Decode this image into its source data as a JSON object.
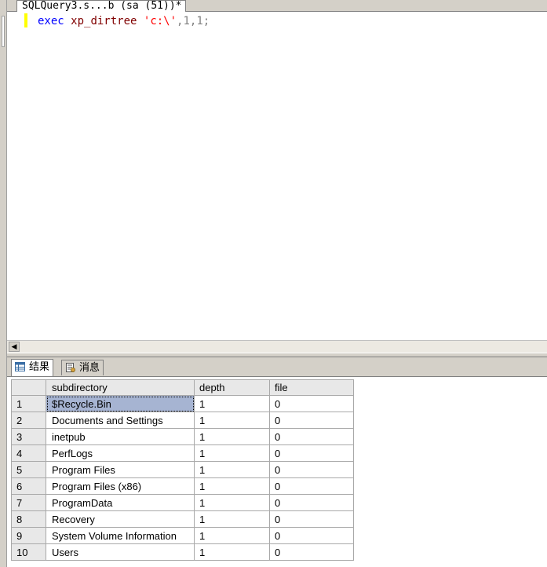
{
  "document_tab": {
    "title": "SQLQuery3.s...b (sa (51))*"
  },
  "editor": {
    "tokens": {
      "keyword": "exec",
      "procedure": "xp_dirtree",
      "string": "'c:\\'",
      "args": ",1,1;"
    }
  },
  "results_tabs": [
    {
      "label": "结果",
      "icon": "grid-icon",
      "active": true
    },
    {
      "label": "消息",
      "icon": "messages-icon",
      "active": false
    }
  ],
  "grid": {
    "columns": [
      "subdirectory",
      "depth",
      "file"
    ],
    "rows": [
      {
        "num": "1",
        "subdirectory": "$Recycle.Bin",
        "depth": "1",
        "file": "0"
      },
      {
        "num": "2",
        "subdirectory": "Documents and Settings",
        "depth": "1",
        "file": "0"
      },
      {
        "num": "3",
        "subdirectory": "inetpub",
        "depth": "1",
        "file": "0"
      },
      {
        "num": "4",
        "subdirectory": "PerfLogs",
        "depth": "1",
        "file": "0"
      },
      {
        "num": "5",
        "subdirectory": "Program Files",
        "depth": "1",
        "file": "0"
      },
      {
        "num": "6",
        "subdirectory": "Program Files (x86)",
        "depth": "1",
        "file": "0"
      },
      {
        "num": "7",
        "subdirectory": "ProgramData",
        "depth": "1",
        "file": "0"
      },
      {
        "num": "8",
        "subdirectory": "Recovery",
        "depth": "1",
        "file": "0"
      },
      {
        "num": "9",
        "subdirectory": "System Volume Information",
        "depth": "1",
        "file": "0"
      },
      {
        "num": "10",
        "subdirectory": "Users",
        "depth": "1",
        "file": "0"
      }
    ]
  },
  "colors": {
    "selection": "#a6b4d2",
    "keyword": "#0000ff",
    "procedure": "#800000",
    "string": "#ff0000",
    "change_marker": "#ffff00"
  }
}
